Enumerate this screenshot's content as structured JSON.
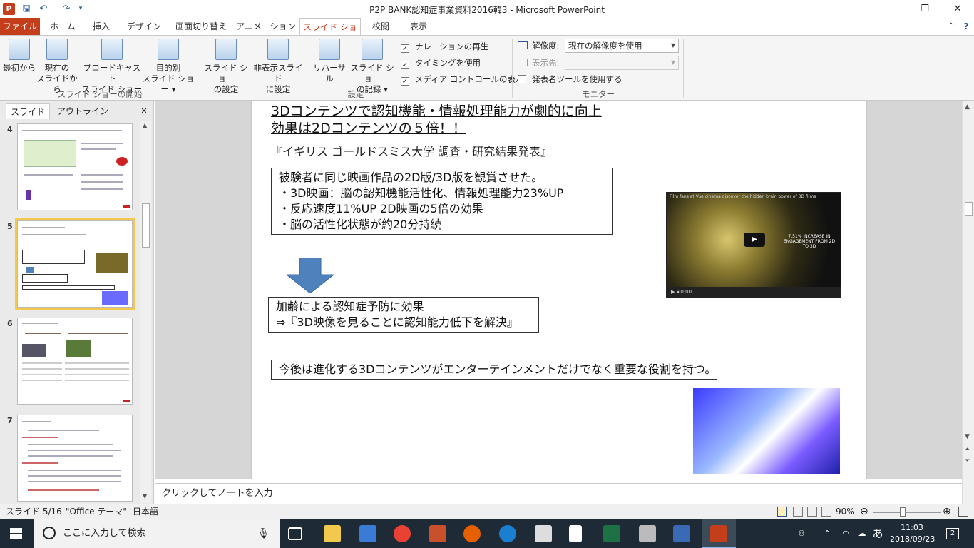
{
  "window": {
    "app_icon": "P",
    "title": "P2P BANK認知症事業資料2016韓3 - Microsoft PowerPoint",
    "minimize": "—",
    "maximize": "❐",
    "close": "✕"
  },
  "quick_access": [
    "save-icon",
    "undo-icon",
    "redo-icon",
    "customize-icon"
  ],
  "tabs": [
    {
      "label": "ファイル"
    },
    {
      "label": "ホーム"
    },
    {
      "label": "挿入"
    },
    {
      "label": "デザイン"
    },
    {
      "label": "画面切り替え"
    },
    {
      "label": "アニメーション"
    },
    {
      "label": "スライド ショー"
    },
    {
      "label": "校閲"
    },
    {
      "label": "表示"
    }
  ],
  "ribbon": {
    "start_group": {
      "label": "スライド ショーの開始",
      "buttons": [
        {
          "line1": "最初から",
          "line2": ""
        },
        {
          "line1": "現在の",
          "line2": "スライドから"
        },
        {
          "line1": "ブロードキャスト",
          "line2": "スライド ショー"
        },
        {
          "line1": "目的別",
          "line2": "スライド ショー ▾"
        }
      ]
    },
    "setup_group": {
      "label": "設定",
      "buttons": [
        {
          "line1": "スライド ショー",
          "line2": "の設定"
        },
        {
          "line1": "非表示スライド",
          "line2": "に設定"
        },
        {
          "line1": "リハーサル",
          "line2": ""
        },
        {
          "line1": "スライド ショー",
          "line2": "の記録 ▾"
        }
      ],
      "checkboxes": [
        {
          "label": "ナレーションの再生",
          "checked": true
        },
        {
          "label": "タイミングを使用",
          "checked": true
        },
        {
          "label": "メディア コントロールの表示",
          "checked": true
        }
      ]
    },
    "monitor_group": {
      "label": "モニター",
      "resolution_label": "解像度:",
      "resolution_value": "現在の解像度を使用",
      "display_label": "表示先:",
      "display_value": "",
      "presenter_label": "発表者ツールを使用する"
    }
  },
  "left_panel": {
    "tab_slides": "スライド",
    "tab_outline": "アウトライン",
    "close": "✕",
    "thumbnails": [
      {
        "number": "4"
      },
      {
        "number": "5"
      },
      {
        "number": "6"
      },
      {
        "number": "7"
      }
    ]
  },
  "slide": {
    "heading_line1": "3Dコンテンツで認知機能・情報処理能力が劇的に向上",
    "heading_line2": "効果は2Dコンテンツの５倍！！",
    "source": "『イギリス  ゴールドスミス大学  調査・研究結果発表』",
    "box1": [
      "被験者に同じ映画作品の2D版/3D版を観賞させた。",
      "・3D映画：脳の認知機能活性化、情報処理能力23%UP",
      "・反応速度11%UP   2D映画の5倍の効果",
      "・脳の活性化状態が約20分持続"
    ],
    "box2": [
      "加齢による認知症予防に効果",
      "⇒『3D映像を見ることに認知能力低下を解決』"
    ],
    "box3": "今後は進化する3Dコンテンツがエンターテインメントだけでなく重要な役割を持つ。",
    "video_title": "Film fans at Vue cinema discover the hidden brain power of 3D films",
    "video_caption": "7.51% INCREASE IN ENGAGEMENT FROM 2D TO 3D",
    "video_time": "0:00"
  },
  "notes_placeholder": "クリックしてノートを入力",
  "status": {
    "slide": "スライド 5/16",
    "theme": "\"Office テーマ\"",
    "language": "日本語",
    "zoom": "90%"
  },
  "taskbar": {
    "search_placeholder": "ここに入力して検索",
    "time": "11:03",
    "date": "2018/09/23",
    "ime": "あ",
    "notifications": "2"
  },
  "colors": {
    "accent": "#c43e1c",
    "ribbon_bg": "#f5f5f5",
    "taskbar_bg": "#1e2a35",
    "arrow": "#4f81bd"
  }
}
